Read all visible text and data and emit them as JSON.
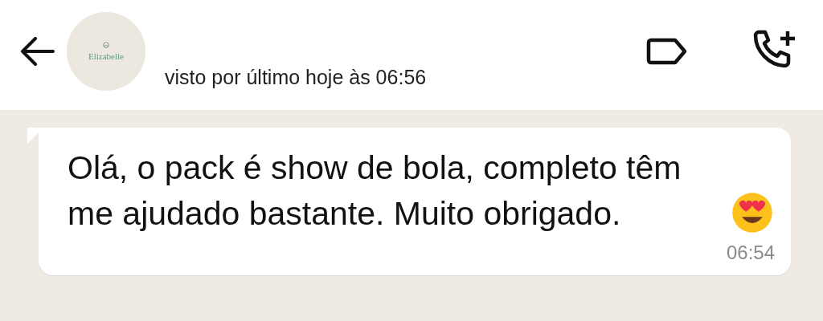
{
  "header": {
    "avatar_text": "Elizabelle",
    "status": "visto por último hoje às 06:56"
  },
  "message": {
    "text": "Olá, o pack é show de bola, completo têm me ajudado bastante. Muito obrigado.",
    "time": "06:54"
  }
}
